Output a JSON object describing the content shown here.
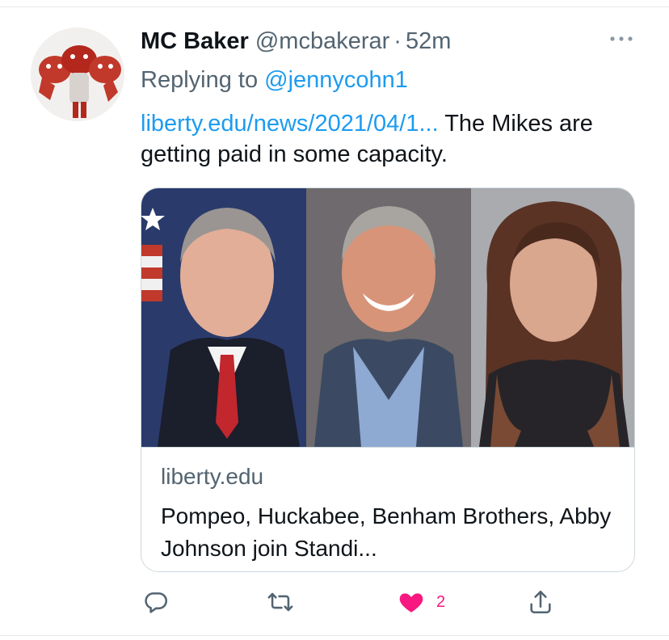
{
  "tweet": {
    "author_name": "MC Baker",
    "handle": "@mcbakerar",
    "separator": "·",
    "timestamp": "52m",
    "replying_prefix": "Replying to ",
    "replying_to": "@jennycohn1",
    "link_text": "liberty.edu/news/2021/04/1...",
    "text_after_link": " The Mikes are getting paid in some capacity.",
    "more_icon": "more-horizontal-icon"
  },
  "card": {
    "domain": "liberty.edu",
    "title": "Pompeo, Huckabee, Benham Brothers, Abby Johnson join Standi..."
  },
  "actions": {
    "reply_icon": "reply-icon",
    "retweet_icon": "retweet-icon",
    "like_icon": "heart-icon",
    "like_count": "2",
    "share_icon": "share-icon",
    "like_color": "#f91880"
  },
  "colors": {
    "link": "#1d9bf0",
    "secondary_text": "#536471",
    "primary_text": "#0f1419"
  }
}
